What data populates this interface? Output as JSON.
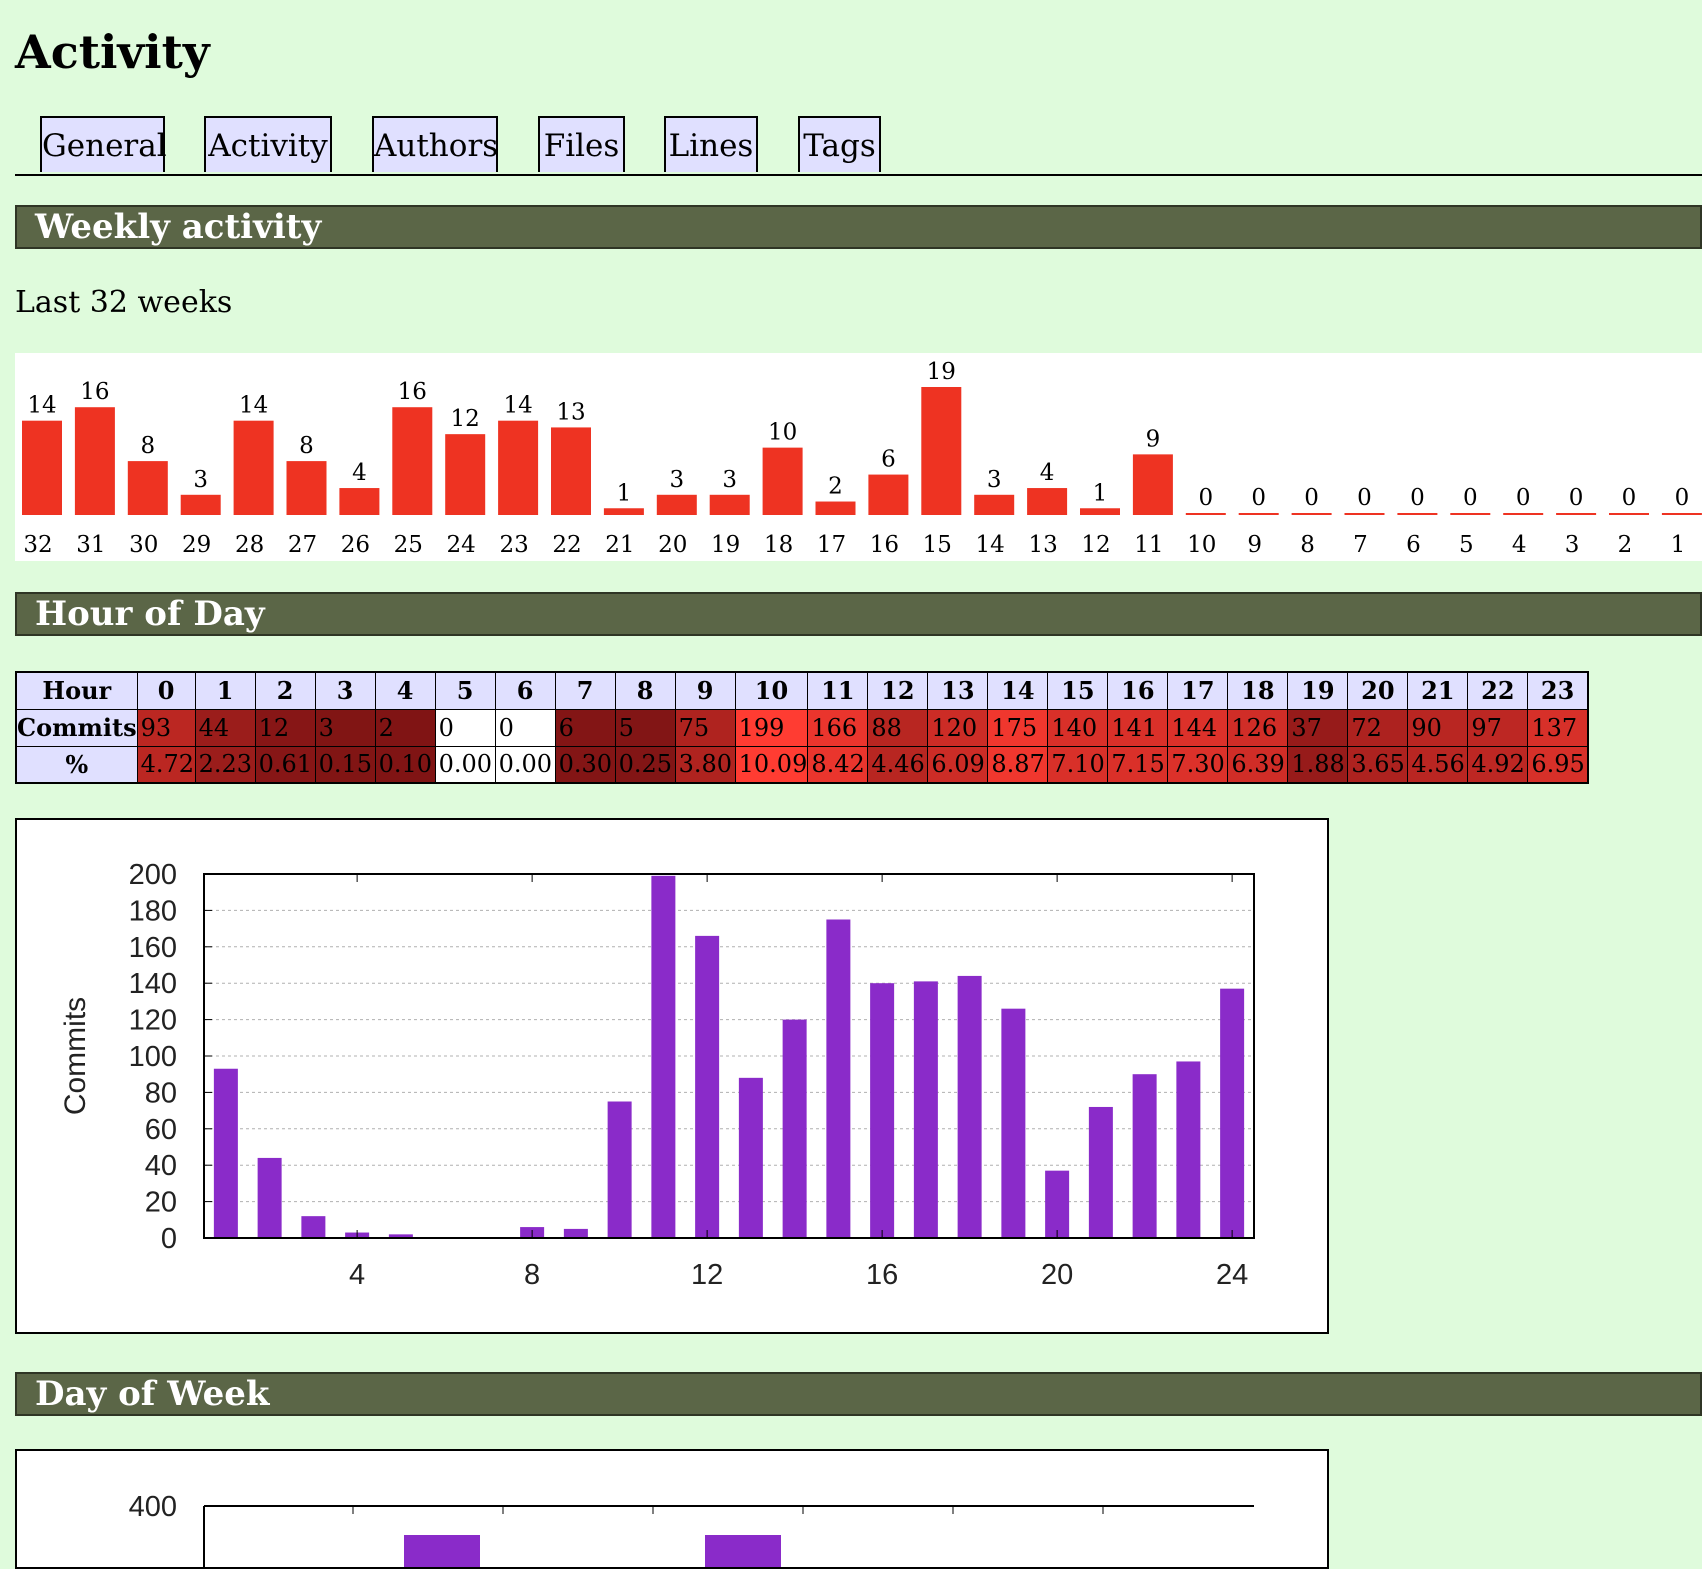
{
  "page": {
    "title": "Activity"
  },
  "nav": {
    "tabs": [
      {
        "label": "General"
      },
      {
        "label": "Activity"
      },
      {
        "label": "Authors"
      },
      {
        "label": "Files"
      },
      {
        "label": "Lines"
      },
      {
        "label": "Tags"
      }
    ]
  },
  "weekly": {
    "heading": "Weekly activity",
    "subtitle": "Last 32 weeks",
    "bar_color": "#ee3322"
  },
  "hour_of_day": {
    "heading": "Hour of Day",
    "table": {
      "row_headers": [
        "Hour",
        "Commits",
        "%"
      ],
      "hours": [
        "0",
        "1",
        "2",
        "3",
        "4",
        "5",
        "6",
        "7",
        "8",
        "9",
        "10",
        "11",
        "12",
        "13",
        "14",
        "15",
        "16",
        "17",
        "18",
        "19",
        "20",
        "21",
        "22",
        "23"
      ],
      "commits": [
        "93",
        "44",
        "12",
        "3",
        "2",
        "0",
        "0",
        "6",
        "5",
        "75",
        "199",
        "166",
        "88",
        "120",
        "175",
        "140",
        "141",
        "144",
        "126",
        "37",
        "72",
        "90",
        "97",
        "137"
      ],
      "percent": [
        "4.72",
        "2.23",
        "0.61",
        "0.15",
        "0.10",
        "0.00",
        "0.00",
        "0.30",
        "0.25",
        "3.80",
        "10.09",
        "8.42",
        "4.46",
        "6.09",
        "8.87",
        "7.10",
        "7.15",
        "7.30",
        "6.39",
        "1.88",
        "3.65",
        "4.56",
        "4.92",
        "6.95"
      ]
    }
  },
  "day_of_week": {
    "heading": "Day of Week"
  },
  "chart_data": [
    {
      "type": "bar",
      "title": "",
      "categories": [
        "32",
        "31",
        "30",
        "29",
        "28",
        "27",
        "26",
        "25",
        "24",
        "23",
        "22",
        "21",
        "20",
        "19",
        "18",
        "17",
        "16",
        "15",
        "14",
        "13",
        "12",
        "11",
        "10",
        "9",
        "8",
        "7",
        "6",
        "5",
        "4",
        "3",
        "2",
        "1"
      ],
      "values": [
        14,
        16,
        8,
        3,
        14,
        8,
        4,
        16,
        12,
        14,
        13,
        1,
        3,
        3,
        10,
        2,
        6,
        19,
        3,
        4,
        1,
        9,
        0,
        0,
        0,
        0,
        0,
        0,
        0,
        0,
        0,
        0
      ],
      "xlabel": "",
      "ylabel": "",
      "ylim": [
        0,
        19
      ],
      "grid": false,
      "color": "#ee3322"
    },
    {
      "type": "bar",
      "title": "",
      "x": [
        1,
        2,
        3,
        4,
        5,
        6,
        7,
        8,
        9,
        10,
        11,
        12,
        13,
        14,
        15,
        16,
        17,
        18,
        19,
        20,
        21,
        22,
        23,
        24
      ],
      "values": [
        93,
        44,
        12,
        3,
        2,
        0,
        0,
        6,
        5,
        75,
        199,
        166,
        88,
        120,
        175,
        140,
        141,
        144,
        126,
        37,
        72,
        90,
        97,
        137
      ],
      "xlabel": "",
      "ylabel": "Commits",
      "xlim": [
        0.5,
        24.5
      ],
      "ylim": [
        0,
        200
      ],
      "xticks": [
        "4",
        "8",
        "12",
        "16",
        "20",
        "24"
      ],
      "yticks": [
        "0",
        "20",
        "40",
        "60",
        "80",
        "100",
        "120",
        "140",
        "160",
        "180",
        "200"
      ],
      "grid": true,
      "color": "#8a2bc9"
    },
    {
      "type": "bar",
      "title": "",
      "ylim": [
        0,
        400
      ],
      "yticks": [
        "400"
      ],
      "color": "#8a2bc9"
    }
  ]
}
